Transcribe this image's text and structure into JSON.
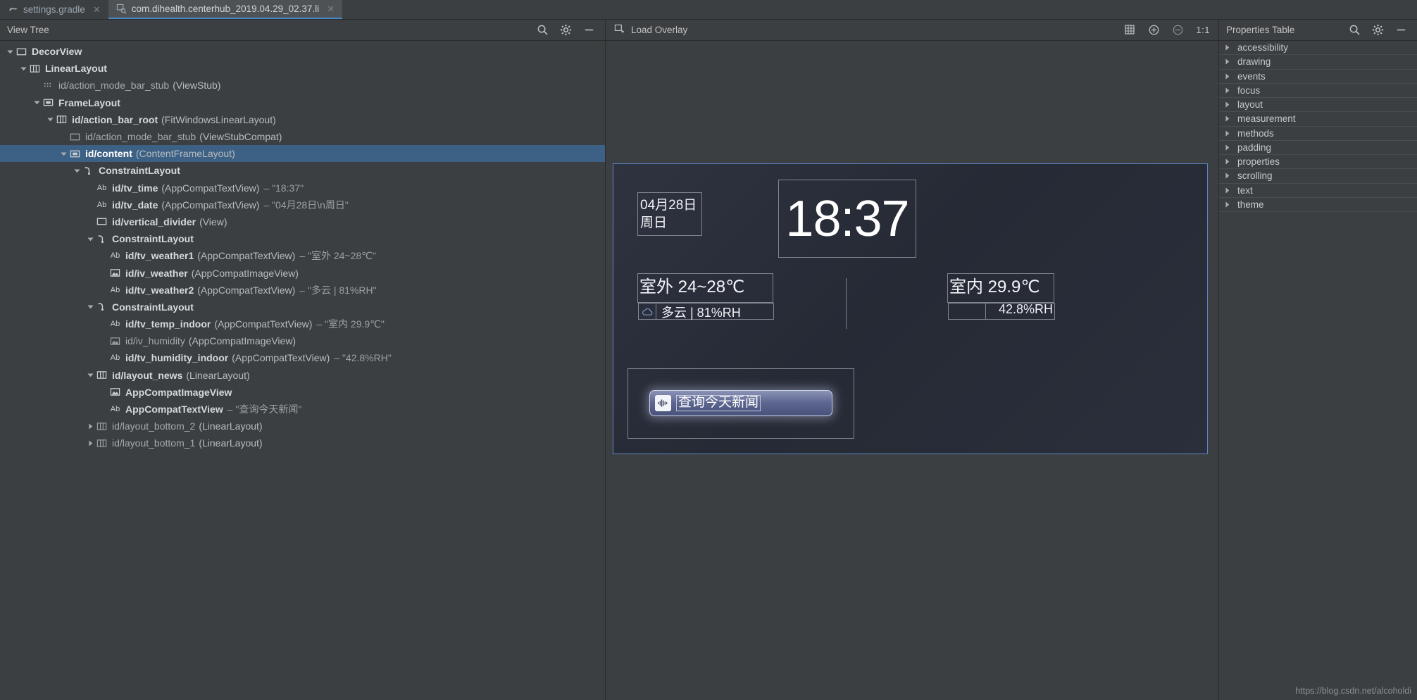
{
  "tabs": [
    {
      "label": "settings.gradle",
      "icon": "gradle-elephant-icon",
      "active": false
    },
    {
      "label": "com.dihealth.centerhub_2019.04.29_02.37.li",
      "icon": "layout-inspector-icon",
      "active": true
    }
  ],
  "left_panel": {
    "title": "View Tree",
    "icons": [
      "search-icon",
      "gear-icon",
      "minimize-icon"
    ],
    "tree": [
      {
        "indent": 0,
        "arrow": "down",
        "icon": "view-icon",
        "name": "DecorView",
        "type": "",
        "value": "",
        "selected": false,
        "dim": false
      },
      {
        "indent": 1,
        "arrow": "down",
        "icon": "linearlayout-icon",
        "name": "LinearLayout",
        "type": "",
        "value": "",
        "selected": false,
        "dim": false
      },
      {
        "indent": 2,
        "arrow": "none",
        "icon": "viewstub-icon",
        "name": "id/action_mode_bar_stub",
        "type": "(ViewStub)",
        "value": "",
        "selected": false,
        "dim": true
      },
      {
        "indent": 2,
        "arrow": "down",
        "icon": "framelayout-icon",
        "name": "FrameLayout",
        "type": "",
        "value": "",
        "selected": false,
        "dim": false
      },
      {
        "indent": 3,
        "arrow": "down",
        "icon": "linearlayout-icon",
        "name": "id/action_bar_root",
        "type": "(FitWindowsLinearLayout)",
        "value": "",
        "selected": false,
        "dim": false
      },
      {
        "indent": 4,
        "arrow": "none",
        "icon": "view-icon",
        "name": "id/action_mode_bar_stub",
        "type": "(ViewStubCompat)",
        "value": "",
        "selected": false,
        "dim": true
      },
      {
        "indent": 4,
        "arrow": "down",
        "icon": "framelayout-icon",
        "name": "id/content",
        "type": "(ContentFrameLayout)",
        "value": "",
        "selected": true,
        "dim": false
      },
      {
        "indent": 5,
        "arrow": "down",
        "icon": "constraint-icon",
        "name": "ConstraintLayout",
        "type": "",
        "value": "",
        "selected": false,
        "dim": false
      },
      {
        "indent": 6,
        "arrow": "none",
        "icon": "text-ab-icon",
        "name": "id/tv_time",
        "type": "(AppCompatTextView)",
        "value": "– \"18:37\"",
        "selected": false,
        "dim": false
      },
      {
        "indent": 6,
        "arrow": "none",
        "icon": "text-ab-icon",
        "name": "id/tv_date",
        "type": "(AppCompatTextView)",
        "value": "– \"04月28日\\n周日\"",
        "selected": false,
        "dim": false
      },
      {
        "indent": 6,
        "arrow": "none",
        "icon": "view-icon",
        "name": "id/vertical_divider",
        "type": "(View)",
        "value": "",
        "selected": false,
        "dim": false
      },
      {
        "indent": 6,
        "arrow": "down",
        "icon": "constraint-icon",
        "name": "ConstraintLayout",
        "type": "",
        "value": "",
        "selected": false,
        "dim": false
      },
      {
        "indent": 7,
        "arrow": "none",
        "icon": "text-ab-icon",
        "name": "id/tv_weather1",
        "type": "(AppCompatTextView)",
        "value": "– \"室外  24~28℃\"",
        "selected": false,
        "dim": false
      },
      {
        "indent": 7,
        "arrow": "none",
        "icon": "image-icon",
        "name": "id/iv_weather",
        "type": "(AppCompatImageView)",
        "value": "",
        "selected": false,
        "dim": false
      },
      {
        "indent": 7,
        "arrow": "none",
        "icon": "text-ab-icon",
        "name": "id/tv_weather2",
        "type": "(AppCompatTextView)",
        "value": "– \"多云 | 81%RH\"",
        "selected": false,
        "dim": false
      },
      {
        "indent": 6,
        "arrow": "down",
        "icon": "constraint-icon",
        "name": "ConstraintLayout",
        "type": "",
        "value": "",
        "selected": false,
        "dim": false
      },
      {
        "indent": 7,
        "arrow": "none",
        "icon": "text-ab-icon",
        "name": "id/tv_temp_indoor",
        "type": "(AppCompatTextView)",
        "value": "– \"室内  29.9℃\"",
        "selected": false,
        "dim": false
      },
      {
        "indent": 7,
        "arrow": "none",
        "icon": "image-icon",
        "name": "id/iv_humidity",
        "type": "(AppCompatImageView)",
        "value": "",
        "selected": false,
        "dim": true
      },
      {
        "indent": 7,
        "arrow": "none",
        "icon": "text-ab-icon",
        "name": "id/tv_humidity_indoor",
        "type": "(AppCompatTextView)",
        "value": "– \"42.8%RH\"",
        "selected": false,
        "dim": false
      },
      {
        "indent": 6,
        "arrow": "down",
        "icon": "linearlayout-icon",
        "name": "id/layout_news",
        "type": "(LinearLayout)",
        "value": "",
        "selected": false,
        "dim": false
      },
      {
        "indent": 7,
        "arrow": "none",
        "icon": "image-icon",
        "name": "AppCompatImageView",
        "type": "",
        "value": "",
        "selected": false,
        "dim": false
      },
      {
        "indent": 7,
        "arrow": "none",
        "icon": "text-ab-icon",
        "name": "AppCompatTextView",
        "type": "",
        "value": "– \"查询今天新闻\"",
        "selected": false,
        "dim": false
      },
      {
        "indent": 6,
        "arrow": "right",
        "icon": "linearlayout-icon",
        "name": "id/layout_bottom_2",
        "type": "(LinearLayout)",
        "value": "",
        "selected": false,
        "dim": true
      },
      {
        "indent": 6,
        "arrow": "right",
        "icon": "linearlayout-icon",
        "name": "id/layout_bottom_1",
        "type": "(LinearLayout)",
        "value": "",
        "selected": false,
        "dim": true
      }
    ]
  },
  "center_panel": {
    "load_overlay_label": "Load Overlay",
    "load_overlay_icon": "load-overlay-icon",
    "toolbar_icons": [
      "grid-icon",
      "zoom-in-icon",
      "zoom-out-icon"
    ],
    "zoom_level": "1:1",
    "preview": {
      "date_line1": "04月28日",
      "date_line2": "周日",
      "time": "18:37",
      "outdoor_temp": "室外  24~28℃",
      "outdoor_weather": "多云 | 81%RH",
      "outdoor_weather_icon": "cloud-icon",
      "indoor_temp": "室内  29.9℃",
      "indoor_humidity": "42.8%RH",
      "news_button": "查询今天新闻",
      "news_button_icon": "voice-waveform-icon",
      "accent_color": "#5d86c4",
      "background_color": "#2b2f3b"
    }
  },
  "right_panel": {
    "title": "Properties Table",
    "icons": [
      "search-icon",
      "gear-icon",
      "minimize-icon"
    ],
    "properties": [
      {
        "label": "accessibility"
      },
      {
        "label": "drawing"
      },
      {
        "label": "events"
      },
      {
        "label": "focus"
      },
      {
        "label": "layout"
      },
      {
        "label": "measurement"
      },
      {
        "label": "methods"
      },
      {
        "label": "padding"
      },
      {
        "label": "properties"
      },
      {
        "label": "scrolling"
      },
      {
        "label": "text"
      },
      {
        "label": "theme"
      }
    ]
  },
  "watermark": "https://blog.csdn.net/alcoholdi"
}
